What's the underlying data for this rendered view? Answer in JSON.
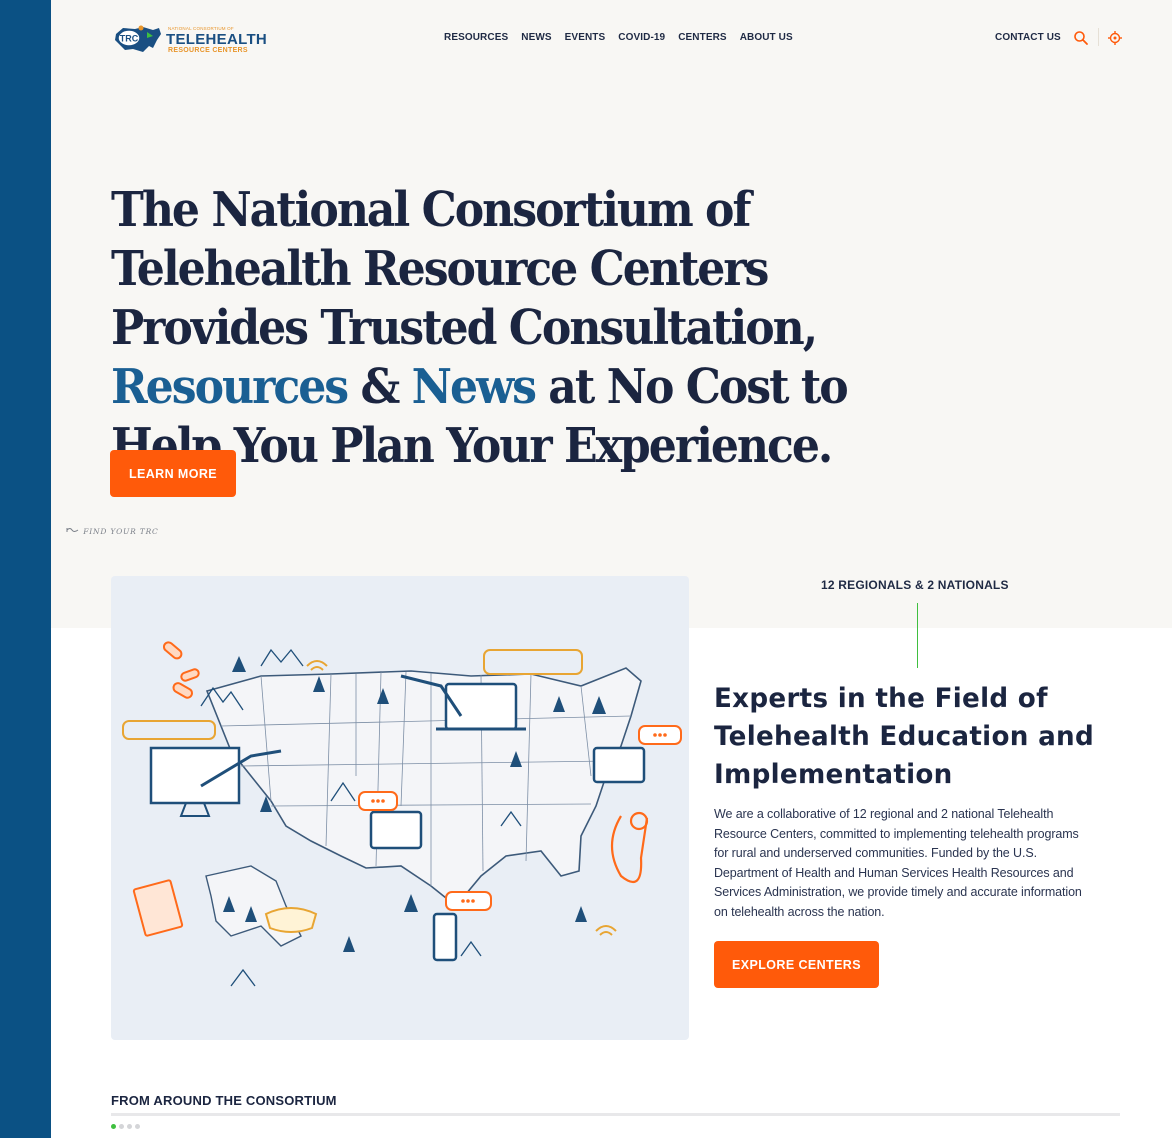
{
  "header": {
    "logo": {
      "badge": "TRC",
      "small_text": "NATIONAL CONSORTIUM OF",
      "main": "TELEHEALTH",
      "sub": "RESOURCE CENTERS"
    },
    "nav": [
      "RESOURCES",
      "NEWS",
      "EVENTS",
      "COVID-19",
      "CENTERS",
      "ABOUT US"
    ],
    "contact": "CONTACT US",
    "search_icon": "search-icon",
    "locate_icon": "locate-target-icon"
  },
  "hero": {
    "title_part1": "The National Consortium of Telehealth Resource Centers Provides Trusted Consultation, ",
    "title_hl1": "Resources",
    "title_amp": " & ",
    "title_hl2": "News",
    "title_part2": " at No Cost to Help You Plan Your Experience.",
    "cta": "LEARN MORE",
    "find_trc": "FIND YOUR TRC"
  },
  "experts": {
    "regionals_label": "12 REGIONALS & 2 NATIONALS",
    "title": "Experts in the Field of Telehealth Education and Implementation",
    "description": "We are a collaborative of 12 regional and 2 national Telehealth Resource Centers, committed to implementing telehealth programs for rural and underserved communities. Funded by the U.S. Department of Health and Human Services Health Resources and Services Administration, we provide timely and accurate information on telehealth across the nation.",
    "cta": "EXPLORE CENTERS"
  },
  "consortium": {
    "title": "FROM AROUND THE CONSORTIUM",
    "carousel_total": 4,
    "carousel_active": 1
  },
  "colors": {
    "left_bar": "#0b5184",
    "accent_orange": "#ff5a0a",
    "navy_text": "#1b2540",
    "highlight_blue": "#1a5f93",
    "accent_green": "#3fbf3f",
    "hero_bg": "#f8f7f4"
  }
}
